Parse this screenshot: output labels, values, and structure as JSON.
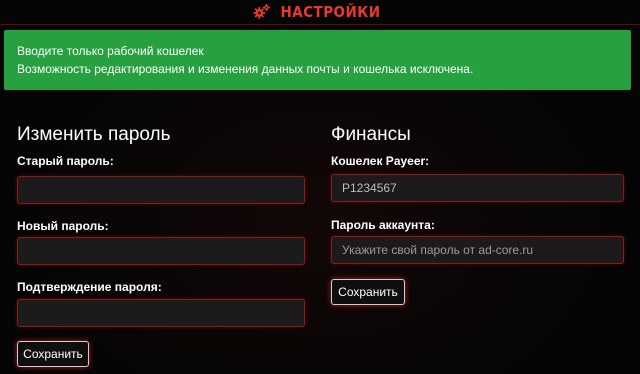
{
  "header": {
    "title": "НАСТРОЙКИ",
    "icon": "gears-icon"
  },
  "alert": {
    "line1": "Вводите только рабочий кошелек",
    "line2": "Возможность редактирования и изменения данных почты и кошелька исключена."
  },
  "password_section": {
    "title": "Изменить пароль",
    "old_label": "Старый пароль:",
    "old_value": "",
    "new_label": "Новый пароль:",
    "new_value": "",
    "confirm_label": "Подтверждение пароля:",
    "confirm_value": "",
    "save_label": "Сохранить"
  },
  "finance_section": {
    "title": "Финансы",
    "wallet_label": "Кошелек Payeer:",
    "wallet_value": "P1234567",
    "account_password_label": "Пароль аккаунта:",
    "account_password_placeholder": "Укажите свой пароль от ad-core.ru",
    "save_label": "Сохранить"
  },
  "colors": {
    "accent_red": "#e8392f",
    "alert_green": "#27a03f",
    "input_border": "#8b1a1a"
  }
}
